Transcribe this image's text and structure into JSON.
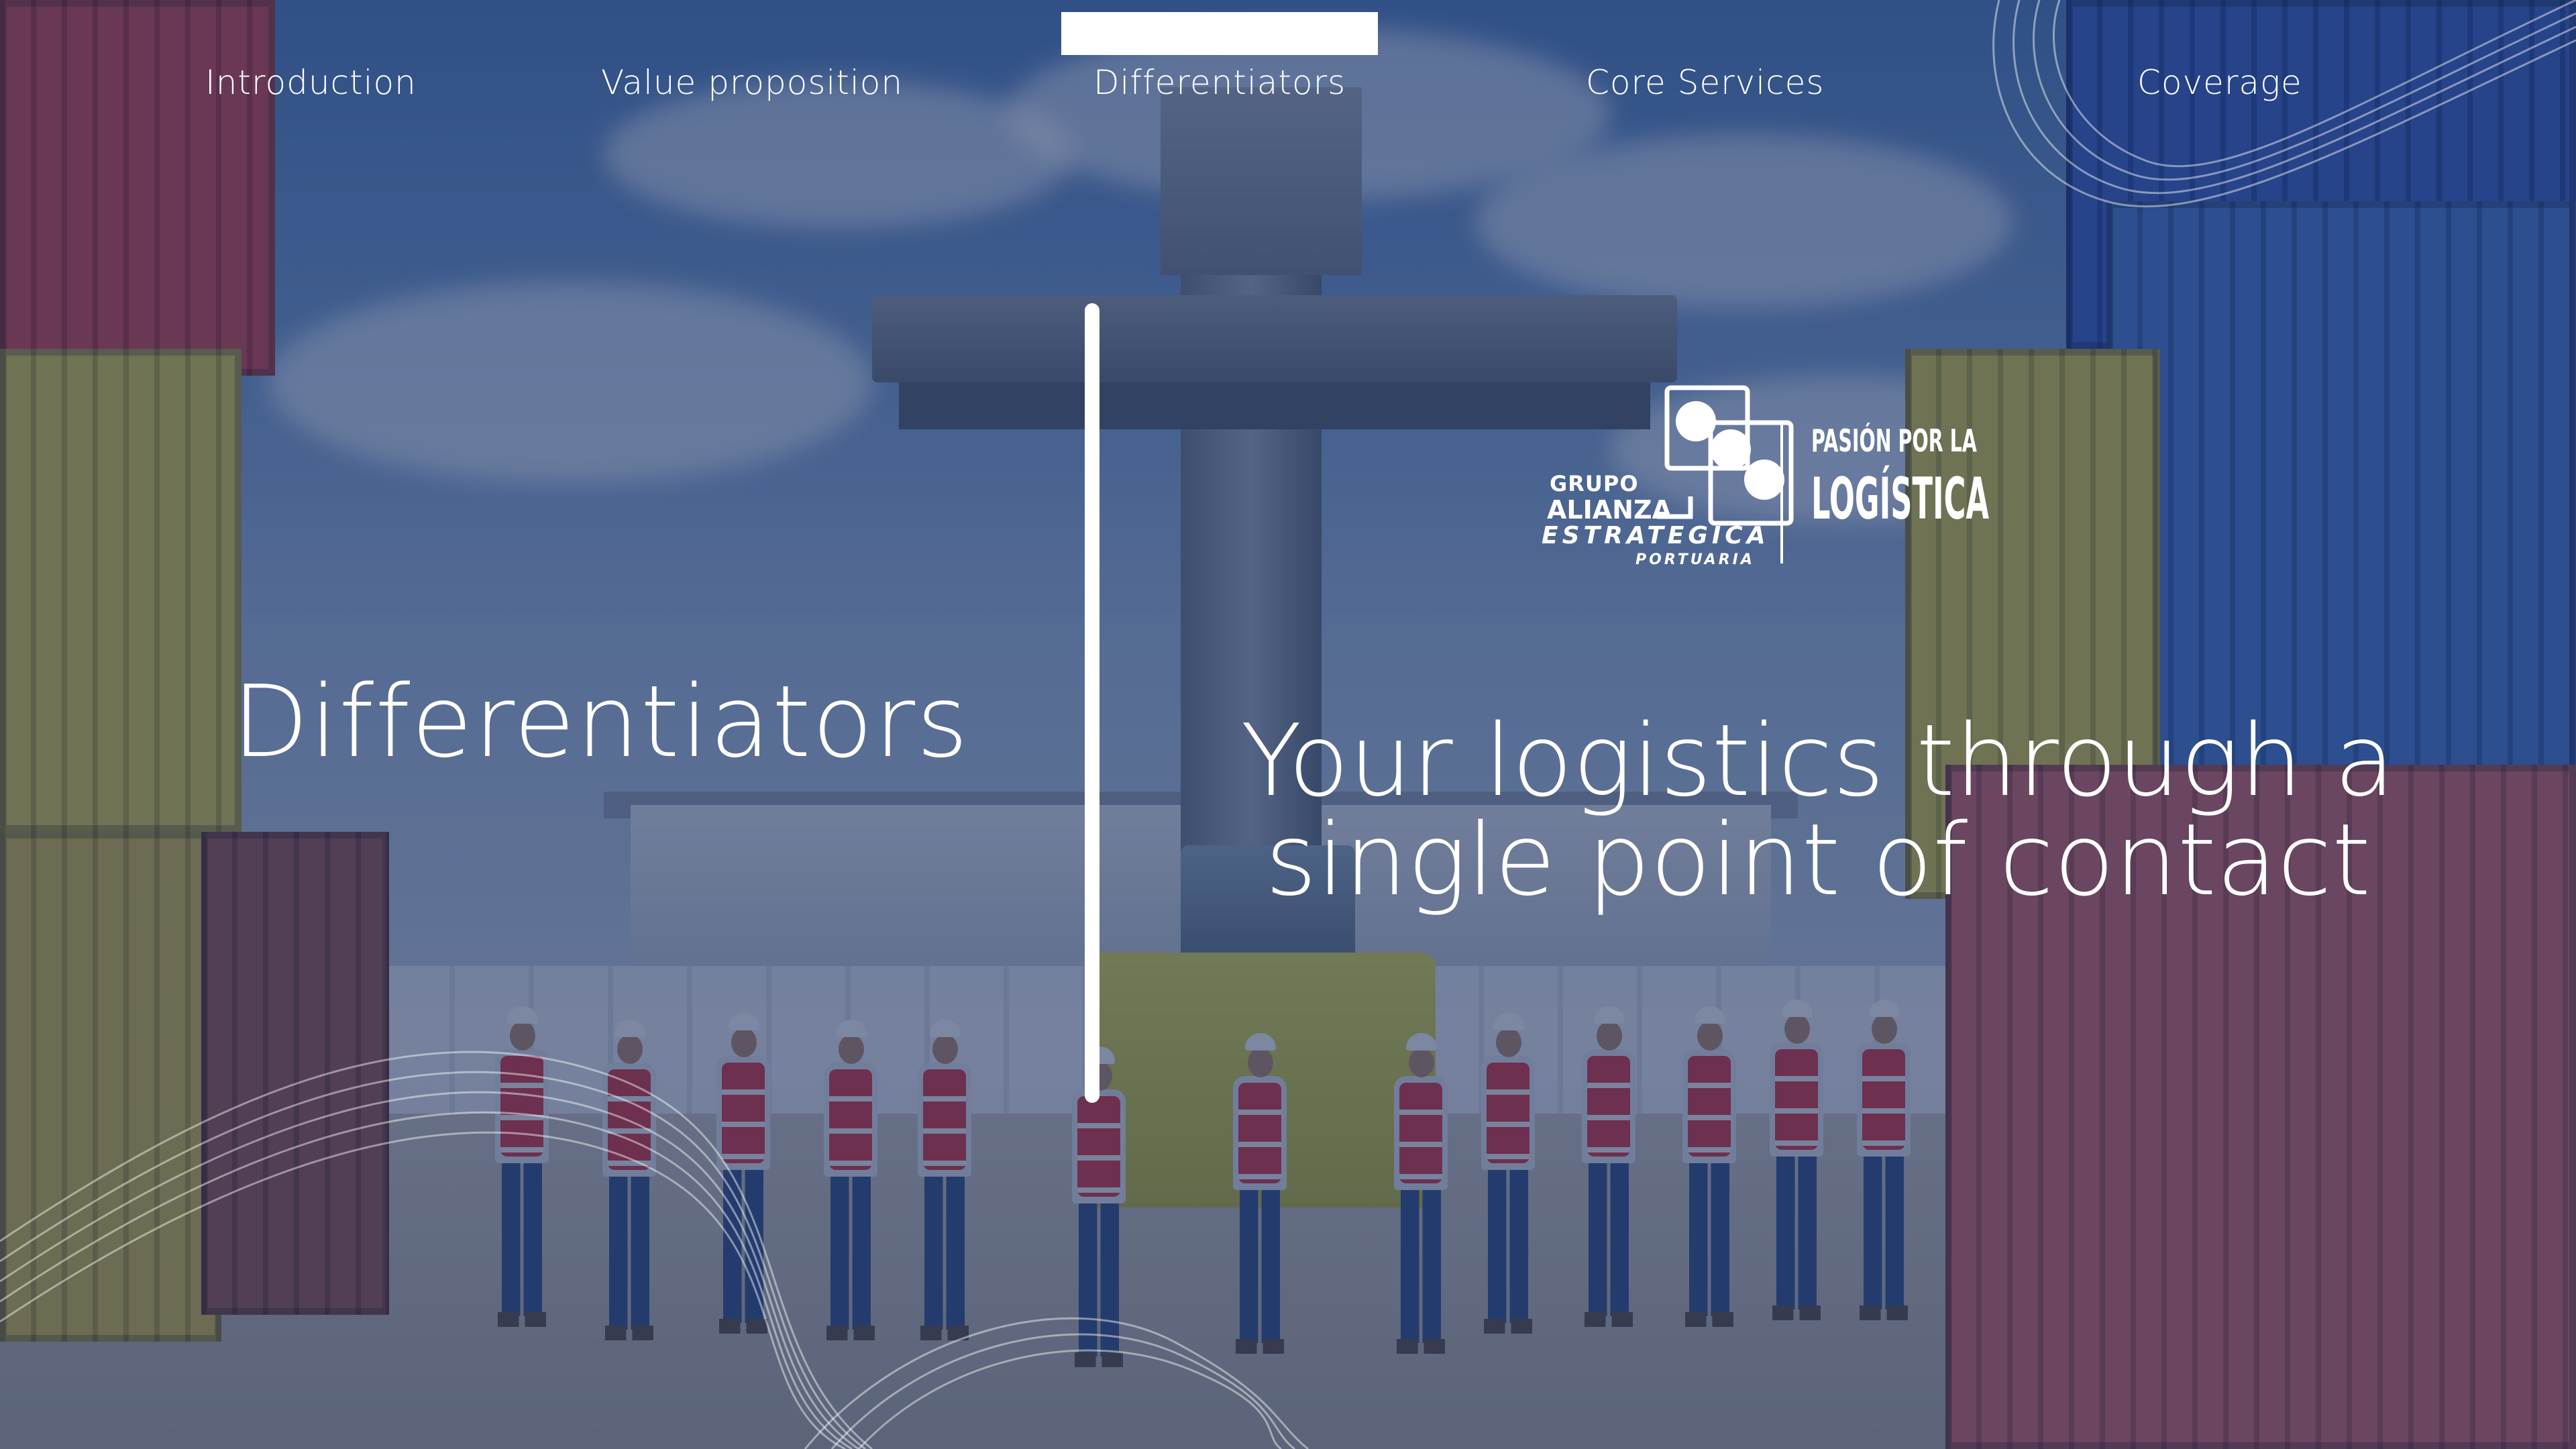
{
  "nav": {
    "items": [
      {
        "label": "Introduction",
        "active": false
      },
      {
        "label": "Value proposition",
        "active": false
      },
      {
        "label": "Differentiators",
        "active": true
      },
      {
        "label": "Core Services",
        "active": false
      },
      {
        "label": "Coverage",
        "active": false
      }
    ]
  },
  "main": {
    "section_title": "Differentiators",
    "tagline_line1": "Your logistics through a",
    "tagline_line2": "single point of contact"
  },
  "logo": {
    "grupo": "GRUPO",
    "alianza": "ALIANZA",
    "estrategica": "ESTRATEGICA",
    "portuaria": "PORTUARIA",
    "slogan_line1": "PASIÓN POR LA",
    "slogan_line2": "LOGÍSTICA"
  },
  "colors": {
    "overlay": "#1c3060",
    "text": "#ffffff",
    "indicator": "#ffffff"
  },
  "icons": {
    "logo_mark": "three-circles-logo-icon"
  }
}
